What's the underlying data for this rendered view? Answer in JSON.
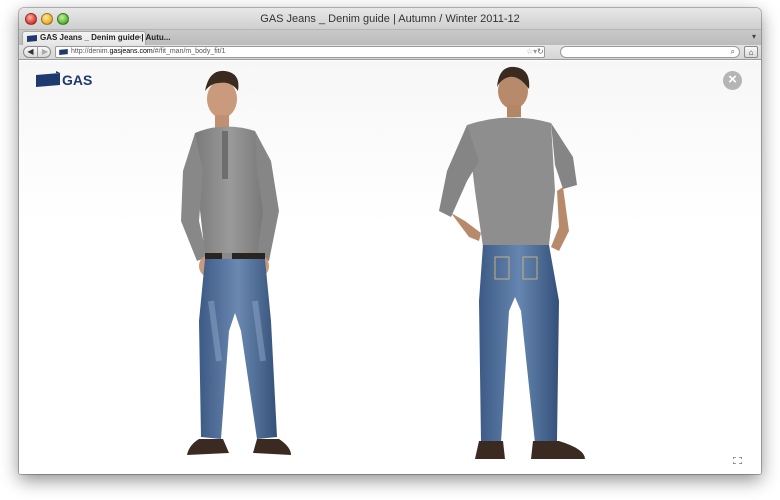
{
  "window": {
    "title": "GAS Jeans _ Denim guide | Autumn / Winter 2011-12"
  },
  "tab": {
    "label": "GAS Jeans _ Denim guide | Autu...",
    "close_icon": "close-icon",
    "favicon": "gas-favicon-icon"
  },
  "toolbar": {
    "back_icon": "back-arrow-icon",
    "forward_icon": "forward-arrow-icon",
    "url_prefix": "http://denim.",
    "url_domain": "gasjeans.com",
    "url_suffix": "/#/fit_man/m_body_fit/1",
    "bookmark_icon": "star-icon",
    "reload_icon": "reload-icon",
    "search_placeholder": "",
    "search_icon": "search-icon",
    "home_icon": "home-icon"
  },
  "page": {
    "brand": "GAS",
    "close_icon": "close-circle-icon",
    "fullscreen_icon": "fullscreen-icon",
    "images": [
      "model-front-view",
      "model-back-view"
    ]
  },
  "colors": {
    "brand_blue": "#1e3a6e",
    "denim": "#4a6a95",
    "shirt_gray": "#8e8e8e",
    "close_gray": "#b5b5b5"
  }
}
